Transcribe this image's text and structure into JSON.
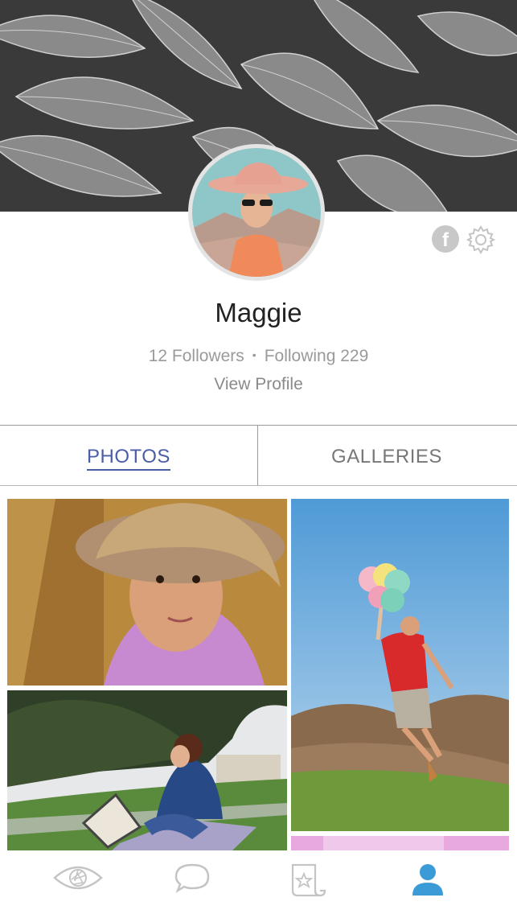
{
  "profile": {
    "name": "Maggie",
    "followers": "12 Followers",
    "separator": "•",
    "following": "Following 229",
    "view_profile": "View Profile"
  },
  "tabs": [
    {
      "label": "PHOTOS",
      "active": true
    },
    {
      "label": "GALLERIES",
      "active": false
    }
  ],
  "icons": {
    "facebook": "facebook-icon",
    "settings": "gear-icon",
    "nav": [
      "eye-aperture-icon",
      "chat-bubble-icon",
      "scroll-star-icon",
      "person-icon"
    ]
  },
  "colors": {
    "accent": "#4a5ea6",
    "nav_active": "#3b9bd6",
    "nav_inactive": "#c4c4c4"
  },
  "navigation": {
    "active_index": 3
  }
}
